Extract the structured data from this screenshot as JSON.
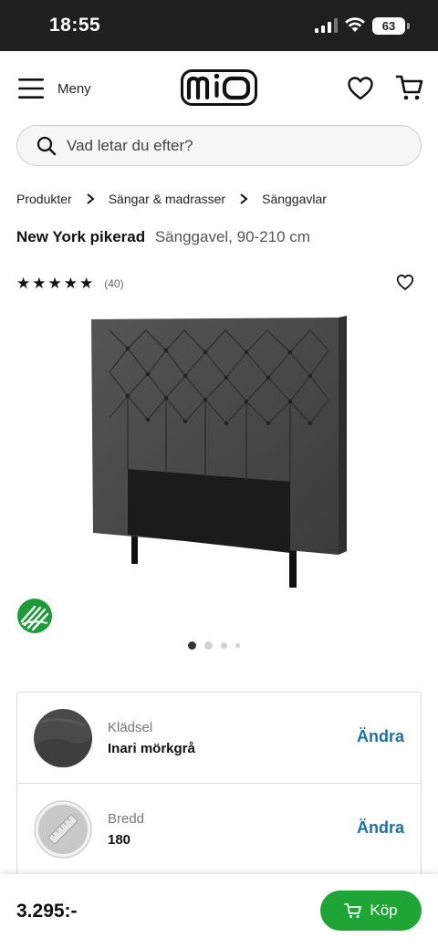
{
  "status_bar": {
    "time": "18:55",
    "battery": "63"
  },
  "header": {
    "menu_label": "Meny",
    "logo_text": "mio"
  },
  "search": {
    "placeholder": "Vad letar du efter?"
  },
  "breadcrumb": [
    "Produkter",
    "Sängar & madrasser",
    "Sänggavlar"
  ],
  "product": {
    "name": "New York pikerad",
    "subtitle": "Sänggavel, 90-210 cm",
    "rating_stars": 5,
    "review_count": "(40)",
    "image_count": 4,
    "active_image": 1
  },
  "options": [
    {
      "label": "Klädsel",
      "value": "Inari mörkgrå",
      "action": "Ändra",
      "icon": "fabric-swatch"
    },
    {
      "label": "Bredd",
      "value": "180",
      "action": "Ändra",
      "icon": "width-ruler-icon"
    }
  ],
  "purchase": {
    "price": "3.295:-",
    "buy_label": "Köp"
  },
  "colors": {
    "accent_green": "#1fa535",
    "link_blue": "#1d6fa8",
    "fabric": "#4a4a4a"
  }
}
